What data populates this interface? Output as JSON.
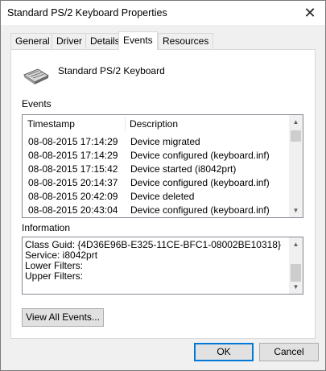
{
  "window": {
    "title": "Standard PS/2 Keyboard Properties",
    "close_glyph": "✕"
  },
  "tabs": [
    {
      "label": "General",
      "active": false
    },
    {
      "label": "Driver",
      "active": false
    },
    {
      "label": "Details",
      "active": false
    },
    {
      "label": "Events",
      "active": true
    },
    {
      "label": "Resources",
      "active": false
    }
  ],
  "device": {
    "name": "Standard PS/2 Keyboard",
    "icon": "keyboard-icon"
  },
  "events": {
    "label": "Events",
    "columns": {
      "timestamp": "Timestamp",
      "description": "Description"
    },
    "rows": [
      {
        "timestamp": "08-08-2015 17:14:29",
        "description": "Device migrated"
      },
      {
        "timestamp": "08-08-2015 17:14:29",
        "description": "Device configured (keyboard.inf)"
      },
      {
        "timestamp": "08-08-2015 17:15:42",
        "description": "Device started (i8042prt)"
      },
      {
        "timestamp": "08-08-2015 20:14:37",
        "description": "Device configured (keyboard.inf)"
      },
      {
        "timestamp": "08-08-2015 20:42:09",
        "description": "Device deleted"
      },
      {
        "timestamp": "08-08-2015 20:43:04",
        "description": "Device configured (keyboard.inf)"
      }
    ]
  },
  "information": {
    "label": "Information",
    "lines": [
      "Class Guid: {4D36E96B-E325-11CE-BFC1-08002BE10318}",
      "Service: i8042prt",
      "Lower Filters:",
      "Upper Filters:"
    ]
  },
  "buttons": {
    "view_all": "View All Events...",
    "ok": "OK",
    "cancel": "Cancel"
  },
  "colors": {
    "accent": "#0078d7",
    "panel_bg": "#ffffff",
    "dialog_bg": "#f0f0f0"
  }
}
